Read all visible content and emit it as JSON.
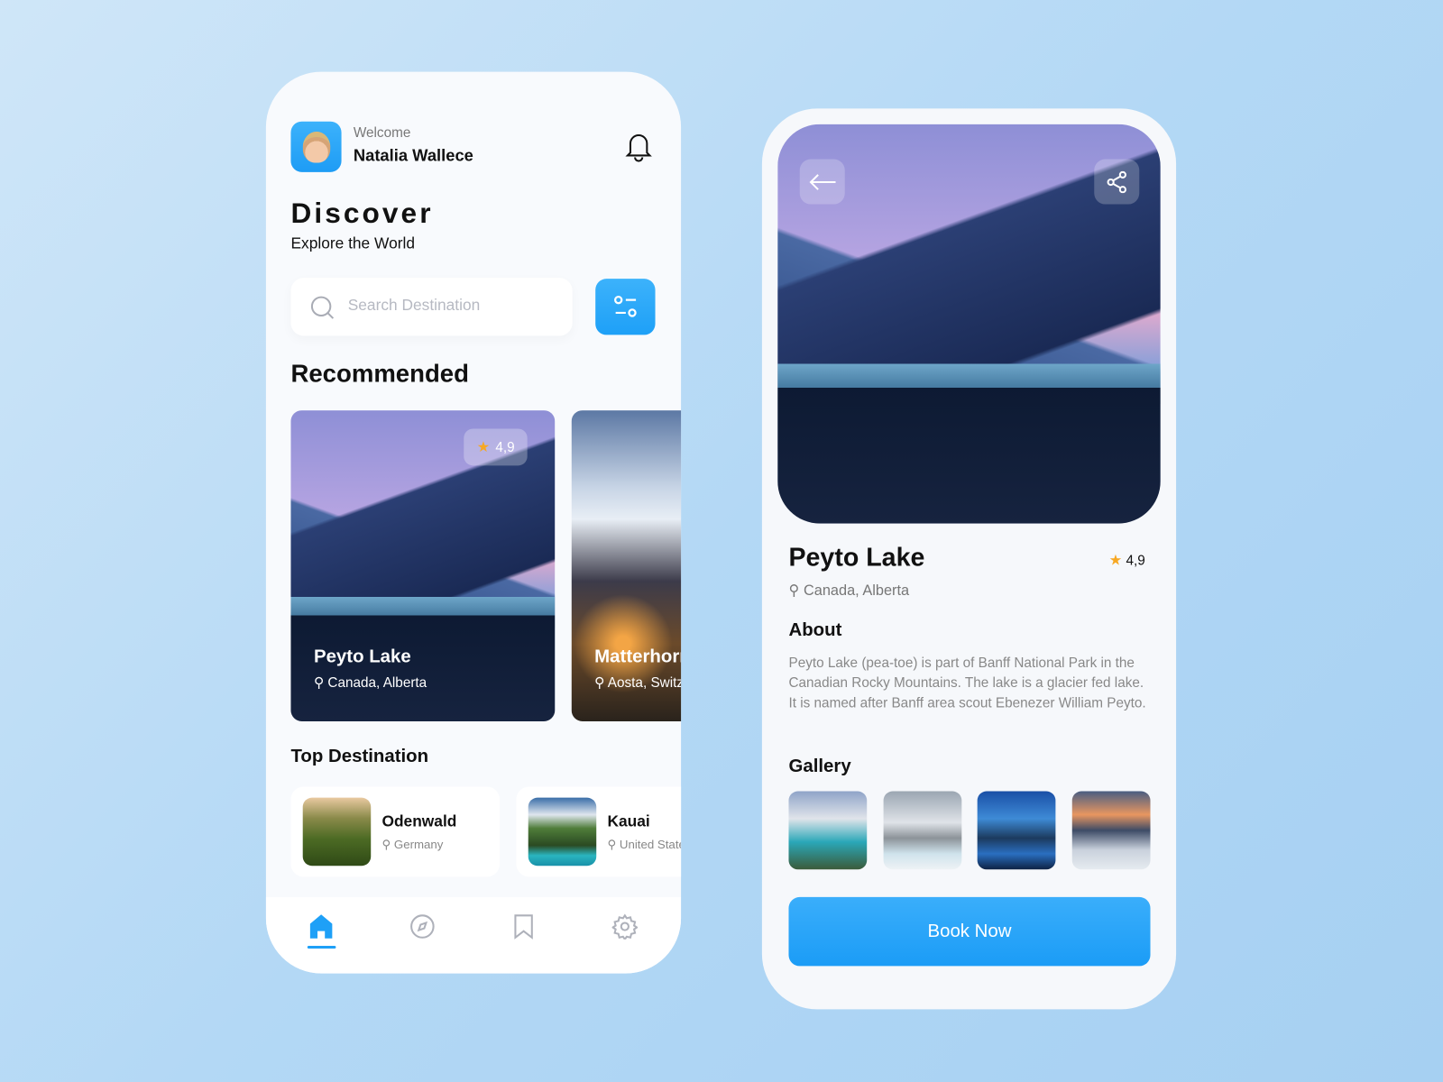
{
  "home": {
    "welcome": "Welcome",
    "user_name": "Natalia Wallece",
    "title": "Discover",
    "subtitle": "Explore the World",
    "search_placeholder": "Search Destination",
    "recommended_heading": "Recommended",
    "recommended": [
      {
        "name": "Peyto Lake",
        "location": "Canada, Alberta",
        "rating": "4,9"
      },
      {
        "name": "Matterhorn",
        "location": "Aosta, Switzerland"
      }
    ],
    "top_heading": "Top Destination",
    "top": [
      {
        "name": "Odenwald",
        "location": "Germany"
      },
      {
        "name": "Kauai",
        "location": "United States"
      }
    ],
    "nav": [
      {
        "icon": "home-icon",
        "active": true
      },
      {
        "icon": "compass-icon",
        "active": false
      },
      {
        "icon": "bookmark-icon",
        "active": false
      },
      {
        "icon": "gear-icon",
        "active": false
      }
    ]
  },
  "detail": {
    "name": "Peyto Lake",
    "location": "Canada, Alberta",
    "rating": "4,9",
    "about_heading": "About",
    "about": "Peyto Lake (pea-toe) is part of Banff National Park in the Canadian Rocky Mountains. The lake is a glacier fed lake. It is named after Banff area scout Ebenezer William Peyto.",
    "gallery_heading": "Gallery",
    "book_label": "Book Now"
  },
  "colors": {
    "accent": "#1ea0f7",
    "star": "#f7a823"
  }
}
